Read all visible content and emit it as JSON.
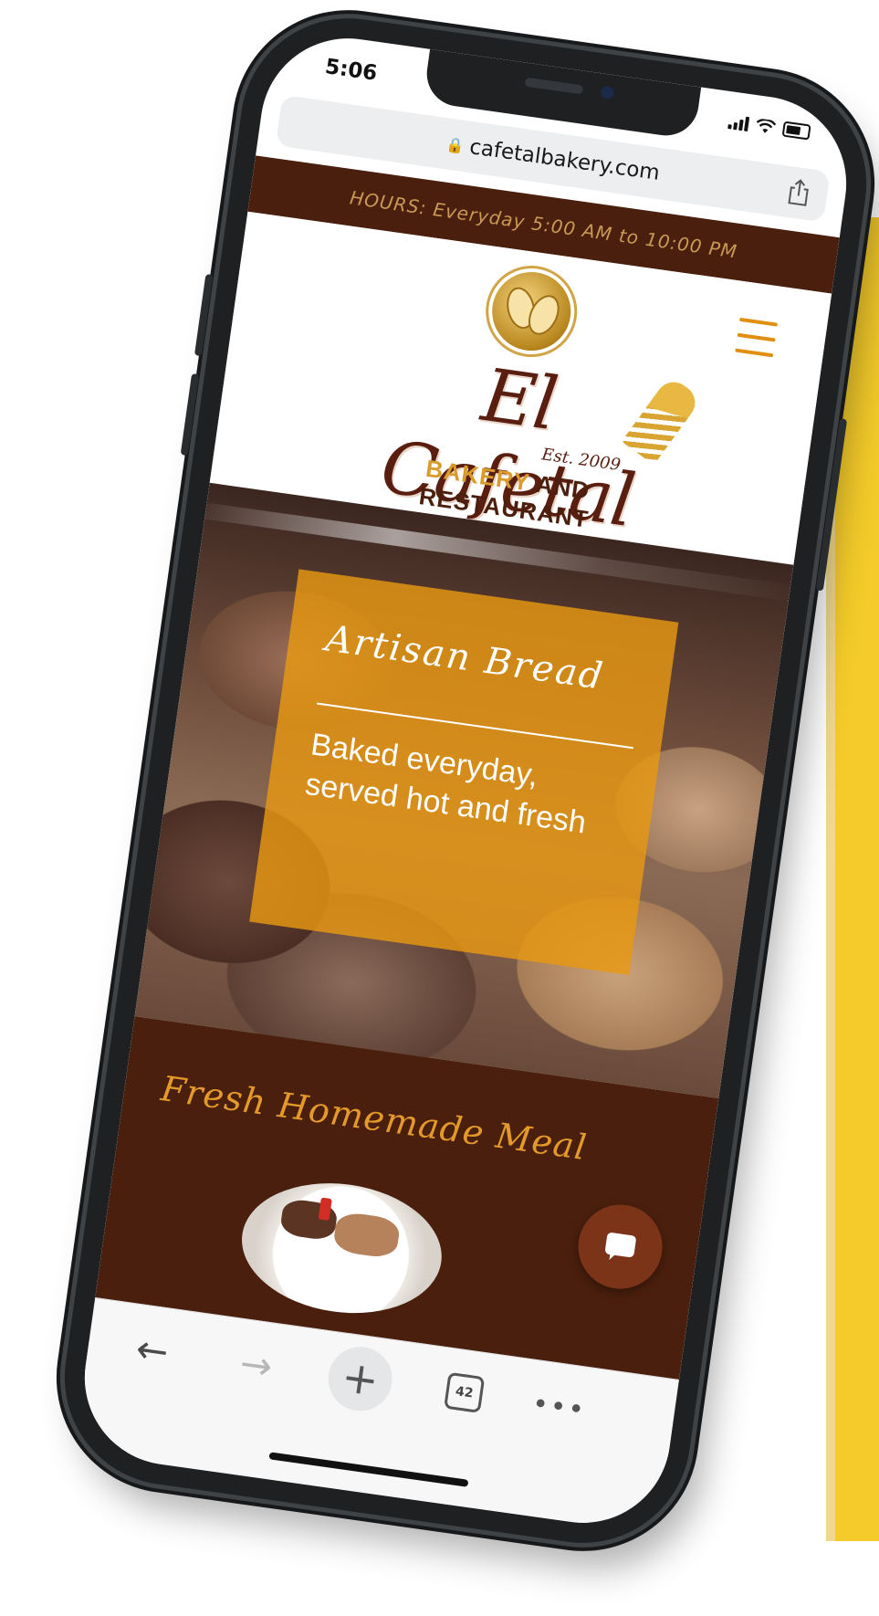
{
  "colors": {
    "accent_orange": "#e8980f",
    "brand_brown": "#4a1f0d",
    "gold": "#d99b2a",
    "yellow_panel": "#f4cb2a"
  },
  "status_bar": {
    "time": "5:06",
    "icons": [
      "signal-icon",
      "wifi-icon",
      "battery-icon"
    ]
  },
  "browser": {
    "url": "cafetalbakery.com",
    "lock_icon": "lock-icon",
    "share_icon": "share-icon"
  },
  "site": {
    "hours": "HOURS: Everyday 5:00 AM to 10:00 PM",
    "menu_icon": "hamburger-menu-icon",
    "logo": {
      "name": "El Cafetal",
      "est": "Est. 2009",
      "tagline_gold": "BAKERY",
      "tagline_rest": " AND RESTAURANT"
    },
    "hero": {
      "title": "Artisan Bread",
      "subtitle_line1": "Baked everyday,",
      "subtitle_line2": "served hot and fresh"
    },
    "meals": {
      "title": "Fresh Homemade Meal"
    },
    "chat_icon": "chat-bubble-icon"
  },
  "toolbar": {
    "back": "←",
    "forward": "→",
    "new_tab": "+",
    "tabs_count": "42",
    "more": "•••"
  }
}
